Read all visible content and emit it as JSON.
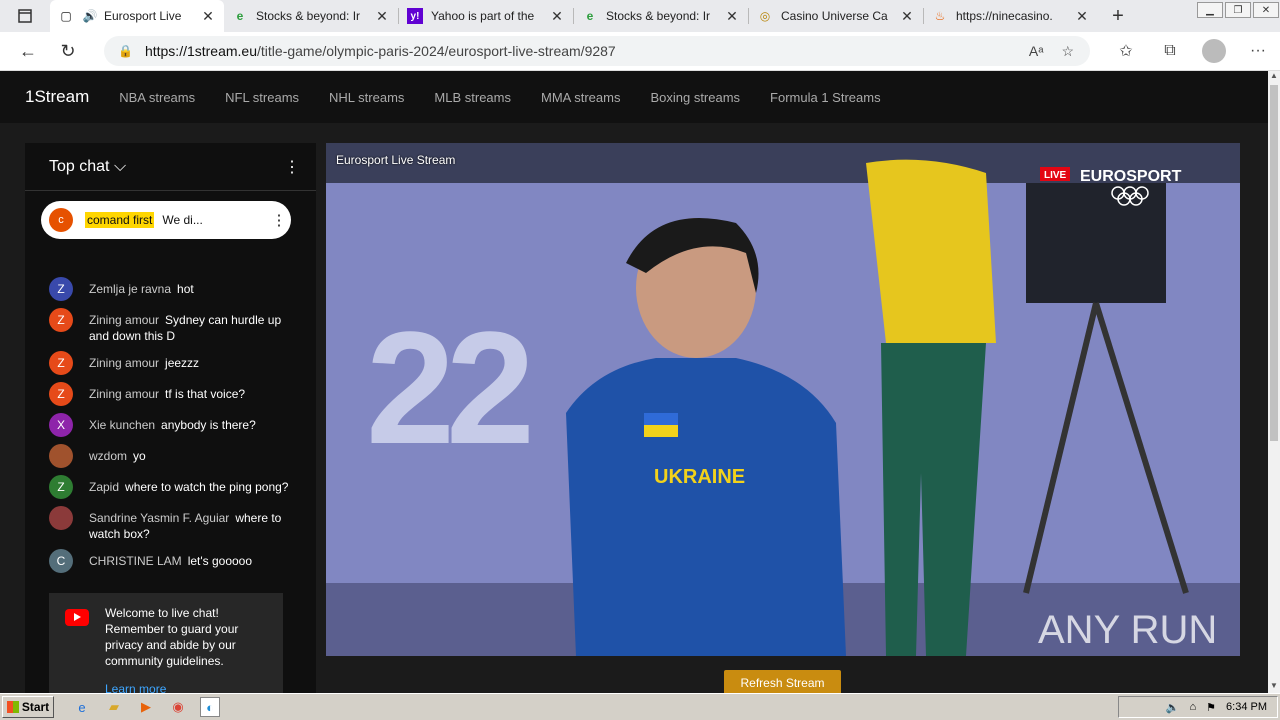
{
  "browser": {
    "tabs": [
      {
        "title": "Eurosport Live",
        "icon": "page-icon",
        "active": true
      },
      {
        "title": "Stocks & beyond: Ir",
        "icon": "e-leaf-icon"
      },
      {
        "title": "Yahoo is part of the",
        "icon": "yahoo-icon"
      },
      {
        "title": "Stocks & beyond: Ir",
        "icon": "e-leaf-icon"
      },
      {
        "title": "Casino Universe Ca",
        "icon": "casino-icon"
      },
      {
        "title": "https://ninecasino.",
        "icon": "ninecasino-icon"
      }
    ],
    "url_domain": "https://1stream.eu",
    "url_path": "/title-game/olympic-paris-2024/eurosport-live-stream/9287"
  },
  "site": {
    "logo": "1Stream",
    "nav": [
      "NBA streams",
      "NFL streams",
      "NHL streams",
      "MLB streams",
      "MMA streams",
      "Boxing streams",
      "Formula 1 Streams"
    ]
  },
  "chat": {
    "header": "Top chat",
    "pinned": {
      "initial": "c",
      "author": "comand first",
      "message": "We di..."
    },
    "messages": [
      {
        "initial": "Z",
        "color": "#3949ab",
        "author": "Zemlja je ravna",
        "text": "hot"
      },
      {
        "initial": "Z",
        "color": "#e64a19",
        "author": "Zining amour",
        "text": "Sydney can hurdle up and down this D"
      },
      {
        "initial": "Z",
        "color": "#e64a19",
        "author": "Zining amour",
        "text": "jeezzz"
      },
      {
        "initial": "Z",
        "color": "#e64a19",
        "author": "Zining amour",
        "text": "tf is that voice?"
      },
      {
        "initial": "X",
        "color": "#8e24aa",
        "author": "Xie kunchen",
        "text": "anybody is there?"
      },
      {
        "initial": "",
        "color": "#a0522d",
        "author": "wzdom",
        "text": "yo"
      },
      {
        "initial": "Z",
        "color": "#2e7d32",
        "author": "Zapid",
        "text": "where to watch the ping pong?"
      },
      {
        "initial": "",
        "color": "#8b3a3a",
        "author": "Sandrine Yasmin F. Aguiar",
        "text": "where to watch box?"
      },
      {
        "initial": "C",
        "color": "#546e7a",
        "author": "CHRISTINE LAM",
        "text": "let's gooooo"
      }
    ],
    "welcome": "Welcome to live chat! Remember to guard your privacy and abide by our community guidelines.",
    "learn_more": "Learn more"
  },
  "video": {
    "label": "Eurosport Live Stream",
    "live_badge": "LIVE",
    "channel": "EUROSPORT",
    "shirt_text": "UKRAINE",
    "watermark": "ANY RUN"
  },
  "refresh_label": "Refresh Stream",
  "taskbar": {
    "start": "Start",
    "time": "6:34 PM"
  }
}
